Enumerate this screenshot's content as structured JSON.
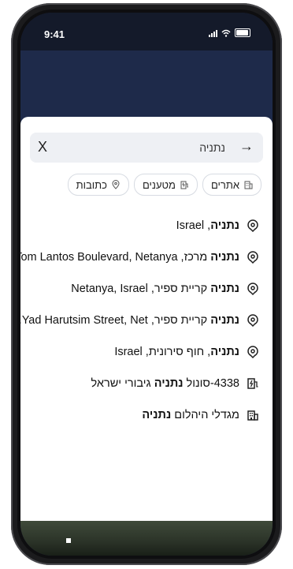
{
  "status": {
    "time": "9:41"
  },
  "search": {
    "query": "נתניה",
    "close_label": "X",
    "submit_arrow": "→"
  },
  "chips": [
    {
      "label": "אתרים",
      "icon": "building-icon"
    },
    {
      "label": "מטענים",
      "icon": "ev-charger-icon"
    },
    {
      "label": "כתובות",
      "icon": "location-pin-icon"
    }
  ],
  "results": [
    {
      "bold": "נתניה",
      "rest": ", Israel",
      "icon": "location-pin-icon"
    },
    {
      "bold": "נתניה",
      "rest": " מרכז, Tom Lantos Boulevard, Netanya...",
      "icon": "location-pin-icon"
    },
    {
      "bold": "נתניה",
      "rest": " קריית ספיר, Netanya, Israel",
      "icon": "location-pin-icon"
    },
    {
      "bold": "נתניה",
      "rest": " קריית ספיר, Yad Harutsim Street, Net...",
      "icon": "location-pin-icon"
    },
    {
      "bold": "נתניה",
      "rest": ", חוף סירונית, Israel",
      "icon": "location-pin-icon"
    },
    {
      "pre": "4338-סונול ",
      "bold": "נתניה",
      "rest": " גיבורי ישראל",
      "icon": "ev-charger-icon"
    },
    {
      "pre": "מגדלי היהלום ",
      "bold": "נתניה",
      "rest": "",
      "icon": "building-icon"
    }
  ]
}
